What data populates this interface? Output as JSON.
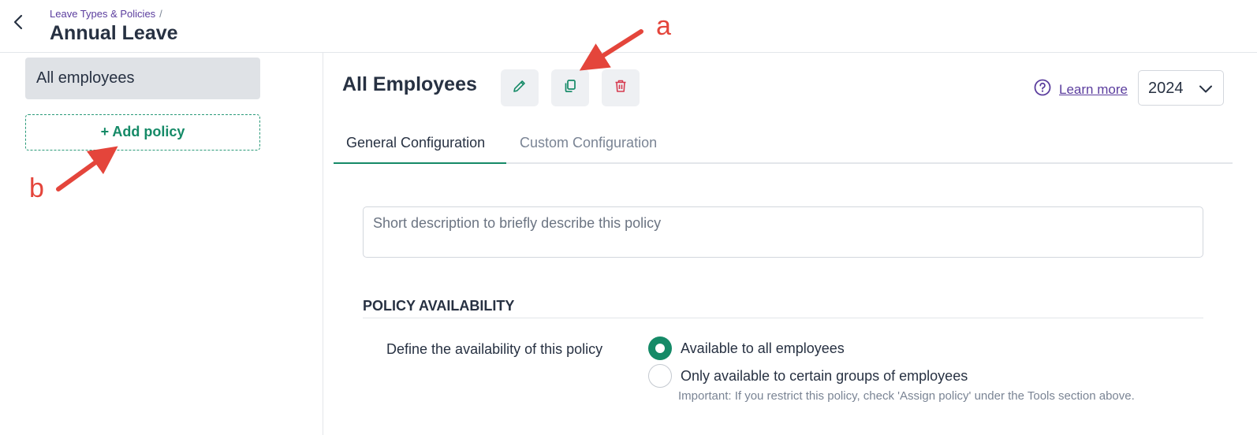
{
  "header": {
    "breadcrumb": "Leave Types & Policies",
    "breadcrumb_sep": "/",
    "title": "Annual Leave"
  },
  "sidebar": {
    "policies": [
      {
        "label": "All employees",
        "selected": true
      }
    ],
    "add_policy_label": "+ Add policy"
  },
  "main": {
    "title": "All Employees",
    "toolbar": {
      "edit_icon": "pencil-icon",
      "copy_icon": "copy-icon",
      "delete_icon": "trash-icon"
    },
    "learn_more": "Learn more",
    "year": "2024",
    "tabs": [
      {
        "label": "General Configuration",
        "active": true
      },
      {
        "label": "Custom Configuration",
        "active": false
      }
    ],
    "description": {
      "value": "",
      "placeholder": "Short description to briefly describe this policy"
    },
    "policy_availability": {
      "heading": "POLICY AVAILABILITY",
      "label": "Define the availability of this policy",
      "options": [
        {
          "label": "Available to all employees",
          "checked": true
        },
        {
          "label": "Only available to certain groups of employees",
          "checked": false
        }
      ],
      "note": "Important: If you restrict this policy, check 'Assign policy' under the Tools section above."
    }
  },
  "annotations": {
    "a": "a",
    "b": "b"
  },
  "colors": {
    "accent": "#158a67",
    "link": "#5b3d9e",
    "danger": "#d63a4f",
    "annotation": "#e4453b"
  }
}
